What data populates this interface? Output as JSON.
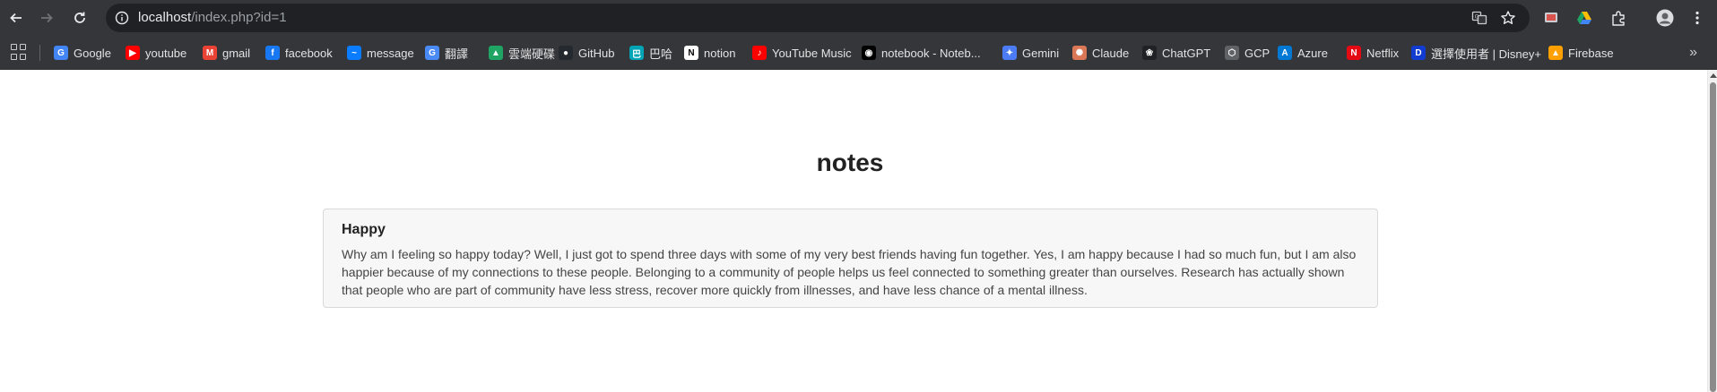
{
  "browser": {
    "url_host": "localhost",
    "url_path": "/index.php?id=1"
  },
  "bookmarks": [
    {
      "label": "Google",
      "icon": "google-icon",
      "color": "#4285f4",
      "glyph": "G"
    },
    {
      "label": "youtube",
      "icon": "youtube-icon",
      "color": "#ff0000",
      "glyph": "▶"
    },
    {
      "label": "gmail",
      "icon": "gmail-icon",
      "color": "#ea4335",
      "glyph": "M"
    },
    {
      "label": "facebook",
      "icon": "facebook-icon",
      "color": "#1877f2",
      "glyph": "f"
    },
    {
      "label": "message",
      "icon": "messenger-icon",
      "color": "#0a7cff",
      "glyph": "~"
    },
    {
      "label": "翻譯",
      "icon": "translate-icon",
      "color": "#4a8af4",
      "glyph": "G"
    },
    {
      "label": "雲端硬碟",
      "icon": "drive-icon",
      "color": "#1fa463",
      "glyph": "▲"
    },
    {
      "label": "GitHub",
      "icon": "github-icon",
      "color": "#24292f",
      "glyph": "●"
    },
    {
      "label": "巴哈",
      "icon": "bahamut-icon",
      "color": "#00a4b4",
      "glyph": "巴"
    },
    {
      "label": "notion",
      "icon": "notion-icon",
      "color": "#ffffff",
      "glyph": "N"
    },
    {
      "label": "YouTube Music",
      "icon": "youtube-music-icon",
      "color": "#ff0000",
      "glyph": "♪"
    },
    {
      "label": "notebook - Noteb...",
      "icon": "notebooklm-icon",
      "color": "#000000",
      "glyph": "◉"
    },
    {
      "label": "Gemini",
      "icon": "gemini-icon",
      "color": "#4b7bf5",
      "glyph": "✦"
    },
    {
      "label": "Claude",
      "icon": "claude-icon",
      "color": "#d97757",
      "glyph": "✺"
    },
    {
      "label": "ChatGPT",
      "icon": "chatgpt-icon",
      "color": "#202124",
      "glyph": "❀"
    },
    {
      "label": "GCP",
      "icon": "gcp-icon",
      "color": "#5f6368",
      "glyph": "⬡"
    },
    {
      "label": "Azure",
      "icon": "azure-icon",
      "color": "#0078d4",
      "glyph": "A"
    },
    {
      "label": "Netflix",
      "icon": "netflix-icon",
      "color": "#e50914",
      "glyph": "N"
    },
    {
      "label": "選擇使用者 | Disney+",
      "icon": "disney-icon",
      "color": "#113ccf",
      "glyph": "D"
    },
    {
      "label": "Firebase",
      "icon": "firebase-icon",
      "color": "#ffa000",
      "glyph": "▲"
    }
  ],
  "page": {
    "title": "notes",
    "note": {
      "title": "Happy",
      "body": "Why am I feeling so happy today? Well, I just got to spend three days with some of my very best friends having fun together. Yes, I am happy because I had so much fun, but I am also happier because of my connections to these people. Belonging to a community of people helps us feel connected to something greater than ourselves. Research has actually shown that people who are part of community have less stress, recover more quickly from illnesses, and have less chance of a mental illness."
    }
  }
}
